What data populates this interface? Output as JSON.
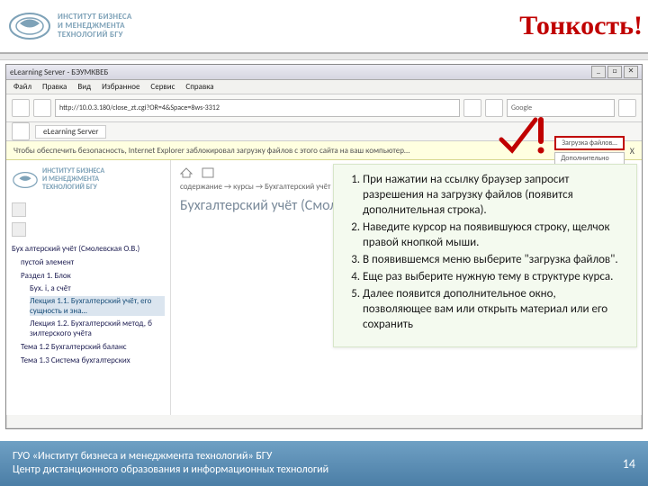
{
  "header": {
    "logo_line1": "ИНСТИТУТ БИЗНЕСА",
    "logo_line2": "И МЕНЕДЖМЕНТА",
    "logo_line3": "ТЕХНОЛОГИЙ БГУ",
    "title": "Тонкость!"
  },
  "browser": {
    "window_title": "eLearning Server - БЭУМКВЕБ",
    "menu": [
      "Файл",
      "Правка",
      "Вид",
      "Избранное",
      "Сервис",
      "Справка"
    ],
    "url": "http://10.0.3.180/close_zt.cgi?OR=4&Space=8ws-3312",
    "search_placeholder": "Google",
    "tab_label": "eLearning Server",
    "infobar": "Чтобы обеспечить безопасность, Internet Explorer заблокировал загрузку файлов с этого сайта на ваш компьютер…",
    "infobar_opts": [
      "Загрузка файлов…",
      "Дополнительно"
    ],
    "close_x": "X",
    "win_min": "_",
    "win_max": "□",
    "win_close": "✕"
  },
  "sidebar": {
    "logo_line1": "ИНСТИТУТ БИЗНЕСА",
    "logo_line2": "И МЕНЕДЖМЕНТА",
    "logo_line3": "ТЕХНОЛОГИЙ БГУ",
    "items": [
      "Бух алтерский учёт (Смолевская О.В.)",
      "пустой элемент",
      "Раздел 1. Блок",
      "Бух. і, a счёт",
      "Лекция 1.1. Бухгалтерский учёт, его сущность и зна…",
      "Лекция 1.2. Бухгалтерский метод, б зилтерского учёта",
      "Тема 1.2 Бухгалтерский баланс",
      "Тема 1.3 Система бухгалтерских"
    ]
  },
  "main": {
    "breadcrumb": "содержание → курсы → Бухгалтерский учёт (Смолевская О.В.)",
    "course_title": "Бухгалтерский учёт (Смолевская О.В.)"
  },
  "instructions": [
    "При нажатии на ссылку браузер запросит разрешения на загрузку файлов (появится дополнительная строка).",
    "Наведите курсор на появившуюся строку, щелчок правой кнопкой мыши.",
    "В появившемся меню выберите \"загрузка файлов\".",
    "Еще раз выберите нужную тему в структуре курса.",
    "Далее появится дополнительное окно, позволяющее вам или открыть материал или его сохранить"
  ],
  "footer": {
    "line1": "ГУО «Институт бизнеса и менеджмента технологий» БГУ",
    "line2": "Центр дистанционного образования и информационных технологий",
    "page": "14"
  }
}
